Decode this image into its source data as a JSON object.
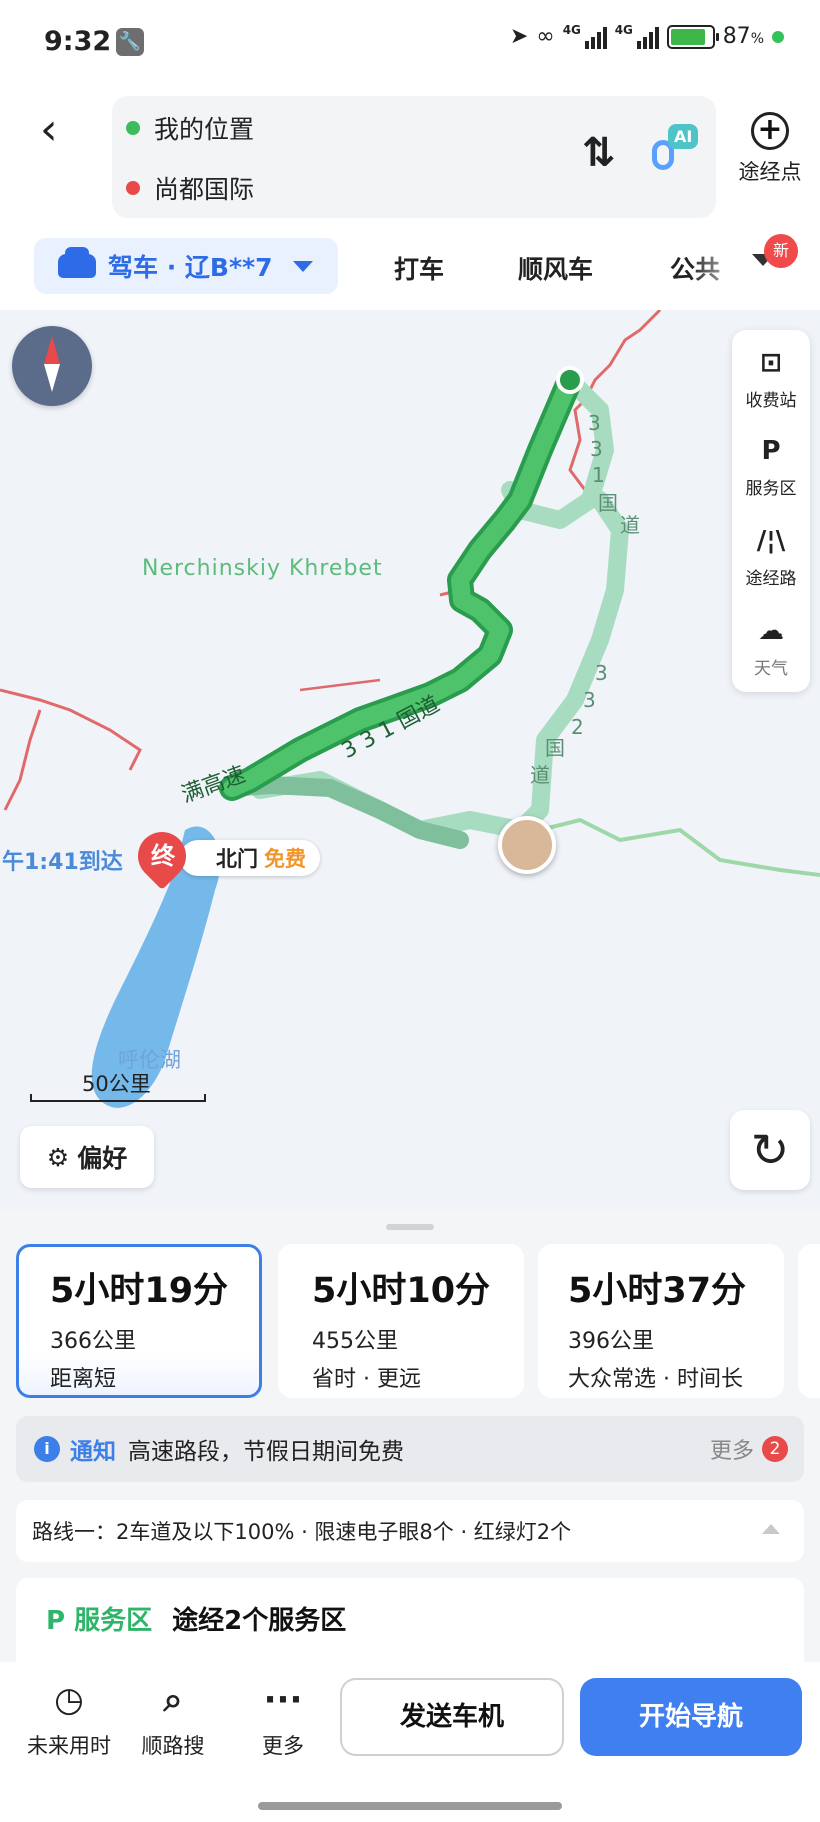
{
  "status": {
    "time": "9:32",
    "sig1": "4G",
    "sig2": "4G",
    "battery": "87",
    "battery_unit": "%",
    "battery_level": 0.87
  },
  "route": {
    "from": "我的位置",
    "to": "尚都国际",
    "waypoint_label": "途经点",
    "ai_label": "AI"
  },
  "modes": {
    "active": "驾车 · 辽B**7",
    "tabs": [
      "打车",
      "顺风车",
      "公共"
    ],
    "new_badge": "新"
  },
  "map": {
    "tools": [
      "收费站",
      "服务区",
      "途经路",
      "天气"
    ],
    "mountain_label": "Nerchinskiy Khrebet",
    "arrival_label": "午1:41到达",
    "lake_label": "呼伦湖",
    "scale": "50公里",
    "pref_label": "偏好",
    "toll_name": "北门",
    "toll_tag": "免费",
    "end_pin": "终",
    "road_331": [
      "3",
      "3",
      "1",
      "国",
      "道"
    ],
    "road_331_b": "3 3 1 国道",
    "road_332": [
      "3",
      "3",
      "2",
      "国",
      "道"
    ],
    "expressway": "满高速"
  },
  "routes": [
    {
      "time": "5小时19分",
      "distance": "366公里",
      "tag": "距离短"
    },
    {
      "time": "5小时10分",
      "distance": "455公里",
      "tag": "省时 · 更远"
    },
    {
      "time": "5小时37分",
      "distance": "396公里",
      "tag": "大众常选 · 时间长"
    }
  ],
  "notice": {
    "title": "通知",
    "text": "高速路段，节假日期间免费",
    "more": "更多",
    "count": "2"
  },
  "route_detail": "路线一：2车道及以下100% · 限速电子眼8个 · 红绿灯2个",
  "service": {
    "title": "服务区",
    "text": "途经2个服务区"
  },
  "actions": {
    "future": "未来用时",
    "search": "顺路搜",
    "more": "更多",
    "send": "发送车机",
    "start": "开始导航"
  },
  "colors": {
    "accent": "#3f7ff0",
    "route_main": "#3dbb5f",
    "route_alt": "#a8dcc0",
    "border": "#e05a5a"
  }
}
